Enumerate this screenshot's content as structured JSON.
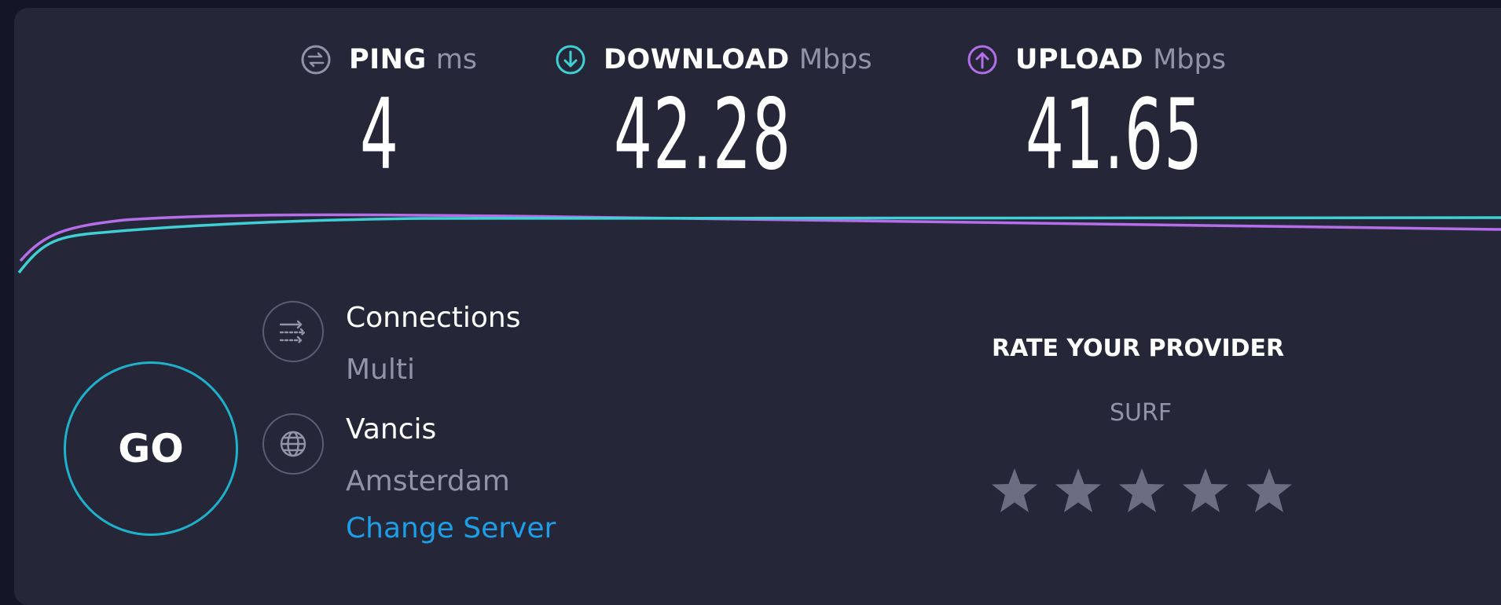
{
  "metrics": {
    "ping": {
      "label": "PING",
      "unit": "ms",
      "value": "4",
      "icon": "ping-icon",
      "color": "#9193a8"
    },
    "download": {
      "label": "DOWNLOAD",
      "unit": "Mbps",
      "value": "42.28",
      "icon": "download-arrow-icon",
      "color": "#3fd0d4"
    },
    "upload": {
      "label": "UPLOAD",
      "unit": "Mbps",
      "value": "41.65",
      "icon": "upload-arrow-icon",
      "color": "#b46ee8"
    }
  },
  "go_button": {
    "label": "GO"
  },
  "connections": {
    "title": "Connections",
    "value": "Multi",
    "icon": "connections-icon"
  },
  "server": {
    "name": "Vancis",
    "location": "Amsterdam",
    "change_label": "Change Server",
    "icon": "globe-icon"
  },
  "rating": {
    "title": "RATE YOUR PROVIDER",
    "provider": "SURF",
    "star_count": 5,
    "selected_stars": 0
  },
  "colors": {
    "background": "#141526",
    "panel": "#252739",
    "accent_cyan": "#1fb1c9",
    "accent_purple": "#b46ee8",
    "link_blue": "#1c9fe8",
    "muted_text": "#9193a8",
    "star_empty": "#6b6d82"
  }
}
